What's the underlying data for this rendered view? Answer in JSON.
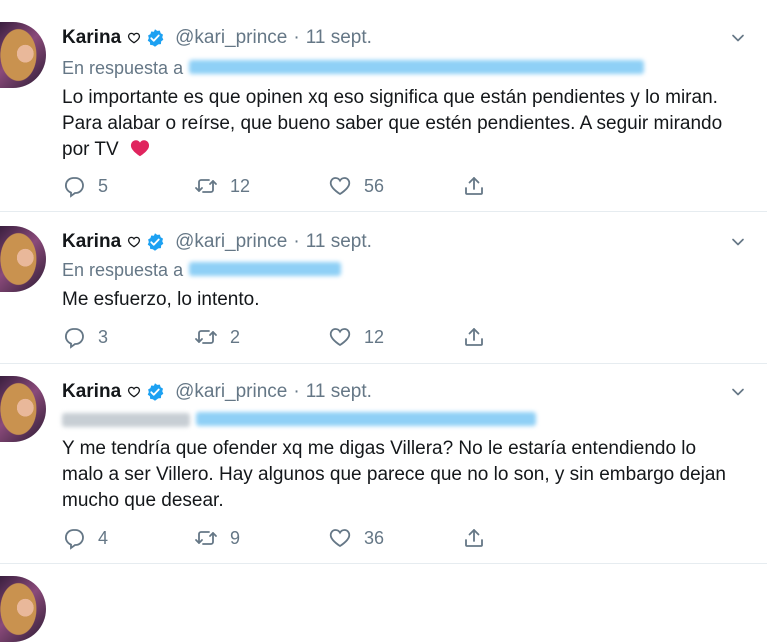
{
  "tweets": [
    {
      "name": "Karina",
      "handle": "@kari_prince",
      "separator": "·",
      "date": "11 sept.",
      "reply_prefix": "En respuesta a",
      "text": "Lo importante es que opinen xq eso significa que están pendientes y lo miran. Para alabar o reírse, que bueno saber que estén pendientes. A seguir mirando por TV",
      "emoji": "❤️",
      "replies": "5",
      "retweets": "12",
      "likes": "56"
    },
    {
      "name": "Karina",
      "handle": "@kari_prince",
      "separator": "·",
      "date": "11 sept.",
      "reply_prefix": "En respuesta a",
      "text": "Me esfuerzo, lo intento.",
      "replies": "3",
      "retweets": "2",
      "likes": "12"
    },
    {
      "name": "Karina",
      "handle": "@kari_prince",
      "separator": "·",
      "date": "11 sept.",
      "text": "Y me tendría que ofender xq me digas Villera? No le estaría entendiendo lo malo a ser Villero. Hay algunos que parece que no lo son, y sin embargo dejan mucho que desear.",
      "replies": "4",
      "retweets": "9",
      "likes": "36"
    }
  ],
  "colors": {
    "accent": "#1da1f2",
    "secondary_text": "#657786",
    "primary_text": "#14171a",
    "heart": "#e0245e",
    "divider": "#e6ecf0"
  },
  "icons": [
    "heart-outline-icon",
    "verified-badge-icon",
    "chevron-down-icon",
    "reply-icon",
    "retweet-icon",
    "like-icon",
    "share-icon"
  ]
}
